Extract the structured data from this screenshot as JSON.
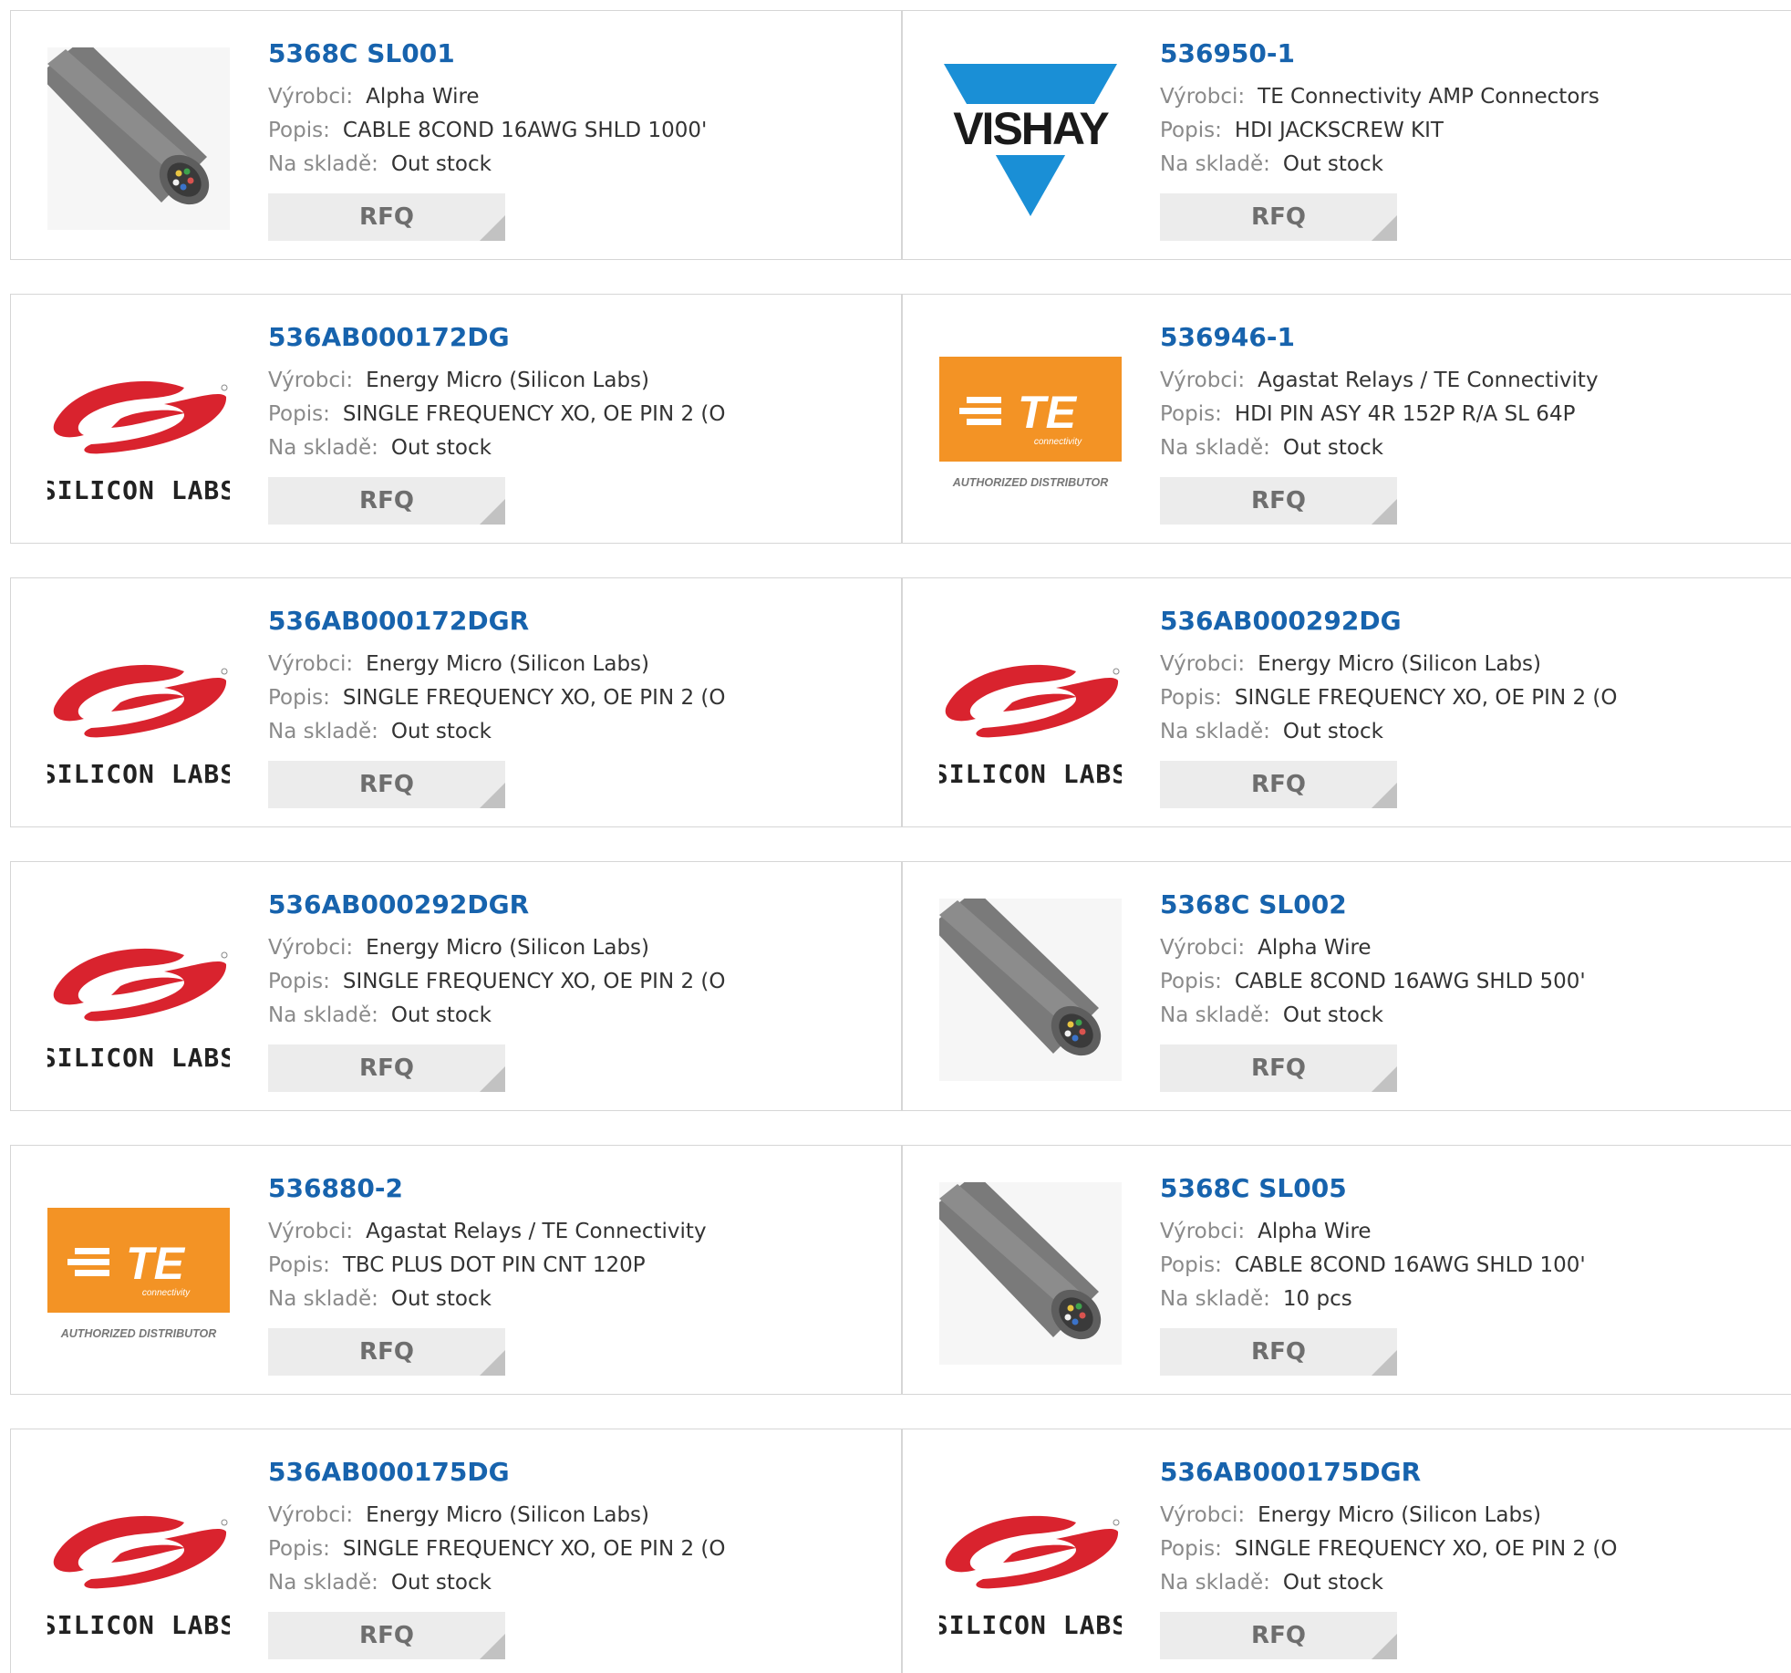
{
  "labels": {
    "manufacturer": "Výrobci:",
    "description": "Popis:",
    "stock": "Na skladě:",
    "rfq": "RFQ"
  },
  "colors": {
    "part_link": "#1763ad",
    "label": "#8a8a8a",
    "value": "#333333",
    "rfq_bg": "#ececec",
    "rfq_text": "#6e6e6e",
    "border": "#d6d6d6",
    "vishay_blue": "#1a8fd6",
    "silicon_labs_red": "#d9232e",
    "te_orange": "#f39325"
  },
  "logos": {
    "vishay": "VISHAY",
    "silicon_labs": "SILICON LABS",
    "te": "TE",
    "te_sub": "connectivity",
    "te_authorized": "AUTHORIZED DISTRIBUTOR"
  },
  "products": [
    {
      "part": "5368C SL001",
      "manufacturer": "Alpha Wire",
      "description": "CABLE 8COND 16AWG SHLD 1000'",
      "stock": "Out stock",
      "image": "cable-photo"
    },
    {
      "part": "536950-1",
      "manufacturer": "TE Connectivity AMP Connectors",
      "description": "HDI JACKSCREW KIT",
      "stock": "Out stock",
      "image": "vishay-logo"
    },
    {
      "part": "536AB000172DG",
      "manufacturer": "Energy Micro (Silicon Labs)",
      "description": "SINGLE FREQUENCY XO, OE PIN 2 (O",
      "stock": "Out stock",
      "image": "silicon-labs-logo"
    },
    {
      "part": "536946-1",
      "manufacturer": "Agastat Relays / TE Connectivity",
      "description": "HDI PIN ASY 4R 152P R/A SL 64P",
      "stock": "Out stock",
      "image": "te-connectivity-logo"
    },
    {
      "part": "536AB000172DGR",
      "manufacturer": "Energy Micro (Silicon Labs)",
      "description": "SINGLE FREQUENCY XO, OE PIN 2 (O",
      "stock": "Out stock",
      "image": "silicon-labs-logo"
    },
    {
      "part": "536AB000292DG",
      "manufacturer": "Energy Micro (Silicon Labs)",
      "description": "SINGLE FREQUENCY XO, OE PIN 2 (O",
      "stock": "Out stock",
      "image": "silicon-labs-logo"
    },
    {
      "part": "536AB000292DGR",
      "manufacturer": "Energy Micro (Silicon Labs)",
      "description": "SINGLE FREQUENCY XO, OE PIN 2 (O",
      "stock": "Out stock",
      "image": "silicon-labs-logo"
    },
    {
      "part": "5368C SL002",
      "manufacturer": "Alpha Wire",
      "description": "CABLE 8COND 16AWG SHLD 500'",
      "stock": "Out stock",
      "image": "cable-photo"
    },
    {
      "part": "536880-2",
      "manufacturer": "Agastat Relays / TE Connectivity",
      "description": "TBC PLUS DOT PIN CNT 120P",
      "stock": "Out stock",
      "image": "te-connectivity-logo"
    },
    {
      "part": "5368C SL005",
      "manufacturer": "Alpha Wire",
      "description": "CABLE 8COND 16AWG SHLD 100'",
      "stock": "10 pcs",
      "image": "cable-photo"
    },
    {
      "part": "536AB000175DG",
      "manufacturer": "Energy Micro (Silicon Labs)",
      "description": "SINGLE FREQUENCY XO, OE PIN 2 (O",
      "stock": "Out stock",
      "image": "silicon-labs-logo"
    },
    {
      "part": "536AB000175DGR",
      "manufacturer": "Energy Micro (Silicon Labs)",
      "description": "SINGLE FREQUENCY XO, OE PIN 2 (O",
      "stock": "Out stock",
      "image": "silicon-labs-logo"
    }
  ]
}
